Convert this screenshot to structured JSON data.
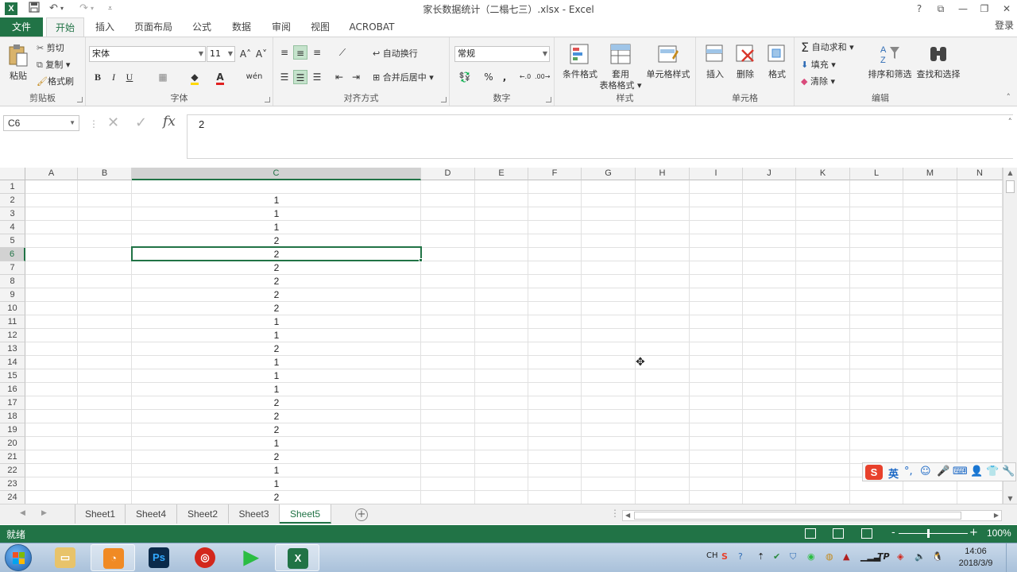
{
  "window": {
    "title": "家长数据统计（二榻七三）.xlsx - Excel",
    "logo_letter": "X",
    "quick_access": [
      "save-icon",
      "undo-icon",
      "redo-icon",
      "customize-icon"
    ],
    "controls": {
      "help": "?",
      "ribbon_options": "⧉",
      "minimize": "—",
      "restore": "❐",
      "close": "✕"
    },
    "login_label": "登录"
  },
  "tabs": {
    "file": "文件",
    "items": [
      "开始",
      "插入",
      "页面布局",
      "公式",
      "数据",
      "审阅",
      "视图",
      "ACROBAT"
    ],
    "active": "开始"
  },
  "ribbon": {
    "clipboard": {
      "label": "剪贴板",
      "paste": "粘贴",
      "cut": "剪切",
      "copy": "复制 ▾",
      "format_painter": "格式刷"
    },
    "font": {
      "label": "字体",
      "name": "宋体",
      "size": "11",
      "bold": "B",
      "italic": "I",
      "underline": "U",
      "grow": "A˄",
      "shrink": "A˅",
      "wen": "wén"
    },
    "alignment": {
      "label": "对齐方式",
      "wrap": "自动换行",
      "merge": "合并后居中 ▾"
    },
    "number": {
      "label": "数字",
      "format": "常规",
      "percent": "%",
      "comma": ",",
      "inc_dec": "←.0",
      "dec_dec": ".00→"
    },
    "styles": {
      "label": "样式",
      "conditional": "条件格式",
      "table_format_1": "套用",
      "table_format_2": "表格格式 ▾",
      "cell_styles": "单元格样式"
    },
    "cells": {
      "label": "单元格",
      "insert": "插入",
      "delete": "删除",
      "format": "格式"
    },
    "editing": {
      "label": "编辑",
      "autosum": "自动求和 ▾",
      "fill": "填充 ▾",
      "clear": "清除 ▾",
      "sort_filter": "排序和筛选",
      "find_select": "查找和选择"
    }
  },
  "formula_bar": {
    "name_box": "C6",
    "formula": "2",
    "cancel": "✕",
    "enter": "✓",
    "fx": "fx"
  },
  "grid": {
    "columns": [
      "A",
      "B",
      "C",
      "D",
      "E",
      "F",
      "G",
      "H",
      "I",
      "J",
      "K",
      "L",
      "M",
      "N"
    ],
    "selected_column": "C",
    "rows": [
      "1",
      "2",
      "3",
      "4",
      "5",
      "6",
      "7",
      "8",
      "9",
      "10",
      "11",
      "12",
      "13",
      "14",
      "15",
      "16",
      "17",
      "18",
      "19",
      "20",
      "21",
      "22",
      "23",
      "24"
    ],
    "selected_row": "6",
    "column_c_values": [
      "",
      "1",
      "1",
      "1",
      "2",
      "2",
      "2",
      "2",
      "2",
      "2",
      "1",
      "1",
      "2",
      "1",
      "1",
      "1",
      "2",
      "2",
      "2",
      "1",
      "2",
      "1",
      "1",
      "2"
    ],
    "active_cell": "C6"
  },
  "sheets": {
    "tabs": [
      "Sheet1",
      "Sheet4",
      "Sheet2",
      "Sheet3",
      "Sheet5"
    ],
    "active": "Sheet5",
    "add_label": "+"
  },
  "status": {
    "text": "就绪",
    "zoom": "100%",
    "zoom_minus": "-",
    "zoom_plus": "+",
    "zoom_level": 100
  },
  "ime": {
    "logo": "S",
    "mode": "英"
  },
  "taskbar": {
    "apps": [
      "file-explorer-icon",
      "uc-browser-icon",
      "photoshop-icon",
      "netease-music-icon",
      "video-player-icon",
      "excel-icon"
    ],
    "ps_label": "Ps",
    "xl_label": "X",
    "tray_lang": "CH",
    "time": "14:06",
    "date": "2018/3/9"
  },
  "colors": {
    "accent": "#217346",
    "selection_header": "#d2d2d2",
    "ime_red": "#e8412c"
  }
}
